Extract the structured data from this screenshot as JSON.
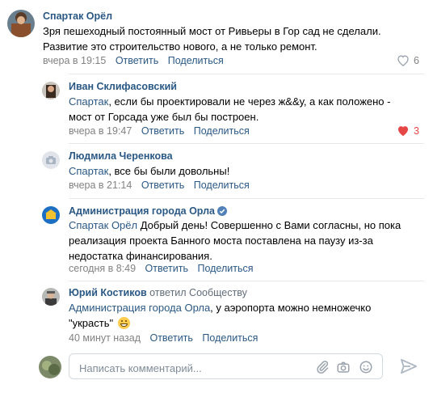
{
  "comments": [
    {
      "author": "Спартак Орёл",
      "text_lines": [
        "Зря пешеходный постоянный мост от Ривьеры в Гор сад не сделали.",
        "Развитие это строительство нового, а не только ремонт."
      ],
      "time": "вчера в 19:15",
      "reply": "Ответить",
      "share": "Поделиться",
      "likes": "6"
    },
    {
      "author": "Иван Склифасовский",
      "mention": "Спартак",
      "text_lines": [
        ", если бы проектировали не через ж&&у, а как положено -",
        "мост от Горсада уже был бы построен."
      ],
      "time": "вчера в 19:47",
      "reply": "Ответить",
      "share": "Поделиться",
      "likes": "3"
    },
    {
      "author": "Людмила Черенкова",
      "mention": "Спартак",
      "text_lines": [
        ", все бы были довольны!"
      ],
      "time": "вчера в 21:14",
      "reply": "Ответить",
      "share": "Поделиться"
    },
    {
      "author": "Администрация города Орла",
      "mention": "Спартак Орёл",
      "text_lines": [
        " Добрый день! Совершенно с Вами согласны, но пока",
        "реализация проекта Банного моста поставлена на паузу из-за",
        "недостатка финансирования."
      ],
      "time": "сегодня в 8:49",
      "reply": "Ответить",
      "share": "Поделиться"
    },
    {
      "author": "Юрий Костиков",
      "author_suffix": "ответил Сообществу",
      "mention": "Администрация города Орла",
      "text_lines": [
        ", у аэропорта можно немножечко",
        "\"украсть\""
      ],
      "time": "40 минут назад",
      "reply": "Ответить",
      "share": "Поделиться"
    }
  ],
  "input": {
    "placeholder": "Написать комментарий..."
  },
  "icons": {
    "attach": "paperclip-icon",
    "camera": "camera-icon",
    "emoji": "smile-icon",
    "send": "send-icon",
    "like": "heart-icon",
    "verified": "verified-icon"
  },
  "colors": {
    "link": "#2a5885",
    "meta": "#828282",
    "liked": "#e64646",
    "divider": "#e7e8ec",
    "icon": "#99a2ad"
  }
}
